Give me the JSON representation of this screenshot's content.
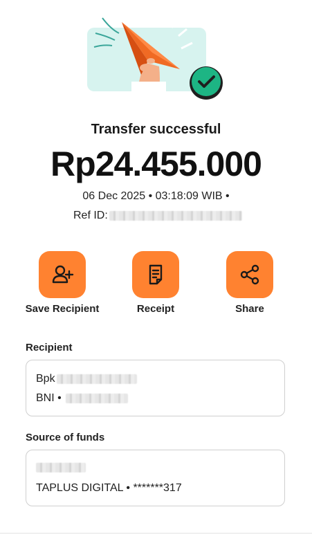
{
  "transfer": {
    "title": "Transfer successful",
    "amount": "Rp24.455.000",
    "datetime": "06 Dec 2025 • 03:18:09 WIB •",
    "ref_label": "Ref ID:"
  },
  "actions": [
    {
      "label": "Save Recipient",
      "icon": "add-person-icon"
    },
    {
      "label": "Receipt",
      "icon": "receipt-icon"
    },
    {
      "label": "Share",
      "icon": "share-icon"
    }
  ],
  "recipient": {
    "section_title": "Recipient",
    "name_prefix": "Bpk",
    "bank_prefix": "BNI •"
  },
  "source": {
    "section_title": "Source of funds",
    "account": "TAPLUS DIGITAL • *******317"
  },
  "colors": {
    "accent": "#ff8230",
    "success": "#1db584",
    "hero_bg": "#d7f3ef"
  }
}
